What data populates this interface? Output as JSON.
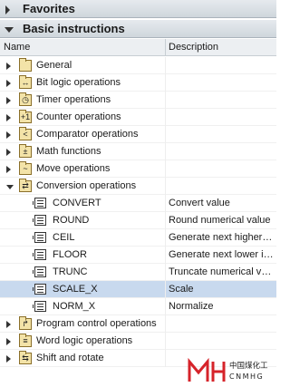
{
  "sections": {
    "favorites": "Favorites",
    "basic": "Basic instructions"
  },
  "columns": {
    "name": "Name",
    "description": "Description"
  },
  "tree": [
    {
      "label": "General",
      "icon": "folder",
      "glyph": "",
      "level": 0,
      "expander": "closed",
      "desc": ""
    },
    {
      "label": "Bit logic operations",
      "icon": "folder",
      "glyph": "↔",
      "level": 0,
      "expander": "closed",
      "desc": ""
    },
    {
      "label": "Timer operations",
      "icon": "folder",
      "glyph": "◷",
      "level": 0,
      "expander": "closed",
      "desc": ""
    },
    {
      "label": "Counter operations",
      "icon": "folder",
      "glyph": "+1",
      "level": 0,
      "expander": "closed",
      "desc": ""
    },
    {
      "label": "Comparator operations",
      "icon": "folder",
      "glyph": "<",
      "level": 0,
      "expander": "closed",
      "desc": ""
    },
    {
      "label": "Math functions",
      "icon": "folder",
      "glyph": "±",
      "level": 0,
      "expander": "closed",
      "desc": ""
    },
    {
      "label": "Move operations",
      "icon": "folder",
      "glyph": "~",
      "level": 0,
      "expander": "closed",
      "desc": ""
    },
    {
      "label": "Conversion operations",
      "icon": "folder",
      "glyph": "⇄",
      "level": 0,
      "expander": "open",
      "desc": ""
    },
    {
      "label": "CONVERT",
      "icon": "instruction",
      "level": 1,
      "expander": "none",
      "desc": "Convert value"
    },
    {
      "label": "ROUND",
      "icon": "instruction",
      "level": 1,
      "expander": "none",
      "desc": "Round numerical value"
    },
    {
      "label": "CEIL",
      "icon": "instruction",
      "level": 1,
      "expander": "none",
      "desc": "Generate next higher integer"
    },
    {
      "label": "FLOOR",
      "icon": "instruction",
      "level": 1,
      "expander": "none",
      "desc": "Generate next lower integer"
    },
    {
      "label": "TRUNC",
      "icon": "instruction",
      "level": 1,
      "expander": "none",
      "desc": "Truncate numerical value"
    },
    {
      "label": "SCALE_X",
      "icon": "instruction",
      "level": 1,
      "expander": "none",
      "desc": "Scale",
      "selected": true
    },
    {
      "label": "NORM_X",
      "icon": "instruction",
      "level": 1,
      "expander": "none",
      "desc": "Normalize"
    },
    {
      "label": "Program control operations",
      "icon": "folder",
      "glyph": "↱",
      "level": 0,
      "expander": "closed",
      "desc": ""
    },
    {
      "label": "Word logic operations",
      "icon": "folder",
      "glyph": "≡",
      "level": 0,
      "expander": "closed",
      "desc": ""
    },
    {
      "label": "Shift and rotate",
      "icon": "folder",
      "glyph": "⇆",
      "level": 0,
      "expander": "closed",
      "desc": ""
    }
  ],
  "watermark": {
    "logo": "MH",
    "line1": "中国煤化工",
    "line2": "CNMHG",
    "color": "#d6232a"
  }
}
